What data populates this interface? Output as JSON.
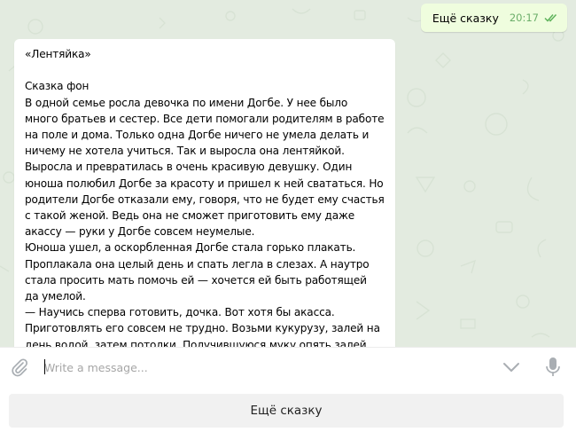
{
  "chat": {
    "outgoing": {
      "text": "Ещё сказку",
      "time": "20:17",
      "status_icon": "double-check-icon",
      "accent_color": "#6cae6a",
      "bubble_color": "#effdde"
    },
    "incoming": {
      "title": "«Лентяйка»",
      "lines": [
        "Сказка фон",
        "В одной семье росла девочка по имени Догбе. У нее было",
        "много братьев и сестер. Все дети помогали родителям в работе",
        "на поле и дома. Только одна Догбе ничего не умела делать и",
        "ничему не хотела учиться. Так и выросла она лентяйкой.",
        "Выросла и превратилась в очень красивую девушку. Один",
        "юноша полюбил Догбе за красоту и пришел к ней свататься. Но",
        "родители Догбе отказали ему, говоря, что не будет ему счастья",
        "с такой женой. Ведь она не сможет приготовить ему даже",
        "акассу — руки у Догбе совсем неумелые.",
        "Юноша ушел, а оскорбленная Догбе стала горько плакать.",
        "Проплакала она целый день и спать легла в слезах. А наутро",
        "стала просить мать помочь ей — хочется ей быть работящей",
        "да умелой.",
        "— Научись сперва готовить, дочка. Вот хотя бы акасса.",
        "Приготовлять его совсем не трудно. Возьми кукурузу, залей на",
        "день водой, затем потолки. Получившуюся муку опять залей"
      ]
    },
    "background_color": "#e3ebe0"
  },
  "composer": {
    "placeholder": "Write a message...",
    "value": "",
    "attach_icon": "paperclip-icon",
    "keyboard_toggle_icon": "chevron-down-icon",
    "voice_icon": "microphone-icon"
  },
  "keyboard": {
    "buttons": [
      {
        "label": "Ещё сказку"
      }
    ]
  }
}
